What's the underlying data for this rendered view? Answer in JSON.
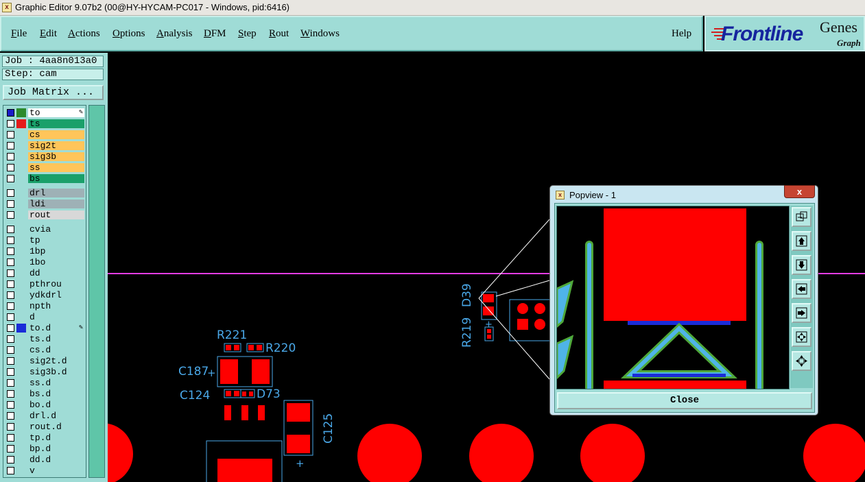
{
  "window": {
    "title": "Graphic Editor 9.07b2 (00@HY-HYCAM-PC017 - Windows, pid:6416)",
    "icon": "app-icon"
  },
  "menu": {
    "items": [
      {
        "label": "File",
        "key": "F"
      },
      {
        "label": "Edit",
        "key": "E"
      },
      {
        "label": "Actions",
        "key": "A"
      },
      {
        "label": "Options",
        "key": "O"
      },
      {
        "label": "Analysis",
        "key": "A"
      },
      {
        "label": "DFM",
        "key": "D"
      },
      {
        "label": "Step",
        "key": "S"
      },
      {
        "label": "Rout",
        "key": "R"
      },
      {
        "label": "Windows",
        "key": "W"
      }
    ],
    "help": "Help"
  },
  "brand": {
    "logo": "Frontline",
    "product": "Genes",
    "sub": "Graph"
  },
  "job": {
    "job_line": "Job : 4aa8n013a0",
    "step_line": "Step: cam",
    "matrix_button": "Job Matrix ..."
  },
  "layers": [
    {
      "name": "to",
      "color": "#ffffff",
      "swatch": "#2c8a2c",
      "selected": true,
      "work": true
    },
    {
      "name": "ts",
      "color": "#1aa06a",
      "swatch": "#e41b1b"
    },
    {
      "name": "cs",
      "color": "#ffc55a"
    },
    {
      "name": "sig2t",
      "color": "#ffc55a"
    },
    {
      "name": "sig3b",
      "color": "#ffc55a"
    },
    {
      "name": "ss",
      "color": "#ffc55a"
    },
    {
      "name": "bs",
      "color": "#1aa06a"
    },
    {
      "name": "drl",
      "color": "#9eb1b6"
    },
    {
      "name": "ldi",
      "color": "#9eb1b6"
    },
    {
      "name": "rout",
      "color": "#d8d8d8"
    },
    {
      "name": "cvia",
      "color": "#9fdcd6"
    },
    {
      "name": "tp",
      "color": "#9fdcd6"
    },
    {
      "name": "1bp",
      "color": "#9fdcd6"
    },
    {
      "name": "1bo",
      "color": "#9fdcd6"
    },
    {
      "name": "dd",
      "color": "#9fdcd6"
    },
    {
      "name": "pthrou",
      "color": "#9fdcd6"
    },
    {
      "name": "ydkdrl",
      "color": "#9fdcd6"
    },
    {
      "name": "npth",
      "color": "#9fdcd6"
    },
    {
      "name": "d",
      "color": "#9fdcd6"
    },
    {
      "name": "to.d",
      "color": "#9fdcd6",
      "swatch": "#1a2cd8",
      "work": true
    },
    {
      "name": "ts.d",
      "color": "#9fdcd6"
    },
    {
      "name": "cs.d",
      "color": "#9fdcd6"
    },
    {
      "name": "sig2t.d",
      "color": "#9fdcd6"
    },
    {
      "name": "sig3b.d",
      "color": "#9fdcd6"
    },
    {
      "name": "ss.d",
      "color": "#9fdcd6"
    },
    {
      "name": "bs.d",
      "color": "#9fdcd6"
    },
    {
      "name": "bo.d",
      "color": "#9fdcd6"
    },
    {
      "name": "drl.d",
      "color": "#9fdcd6"
    },
    {
      "name": "rout.d",
      "color": "#9fdcd6"
    },
    {
      "name": "tp.d",
      "color": "#9fdcd6"
    },
    {
      "name": "bp.d",
      "color": "#9fdcd6"
    },
    {
      "name": "dd.d",
      "color": "#9fdcd6"
    },
    {
      "name": "v",
      "color": "#9fdcd6"
    }
  ],
  "canvas": {
    "refdes": [
      "R221",
      "R220",
      "C187",
      "C124",
      "D73",
      "C125",
      "R219",
      "D39"
    ],
    "colors": {
      "pad": "#ff0000",
      "outline": "#4aa8e8",
      "profile": "#e43ce4",
      "background": "#000000"
    }
  },
  "popview": {
    "title": "Popview - 1",
    "close_label": "Close",
    "close_x": "x",
    "tools": [
      "zoom-fit-icon",
      "pan-up-icon",
      "pan-down-icon",
      "pan-left-icon",
      "pan-right-icon",
      "zoom-out-icon",
      "zoom-in-icon"
    ]
  }
}
